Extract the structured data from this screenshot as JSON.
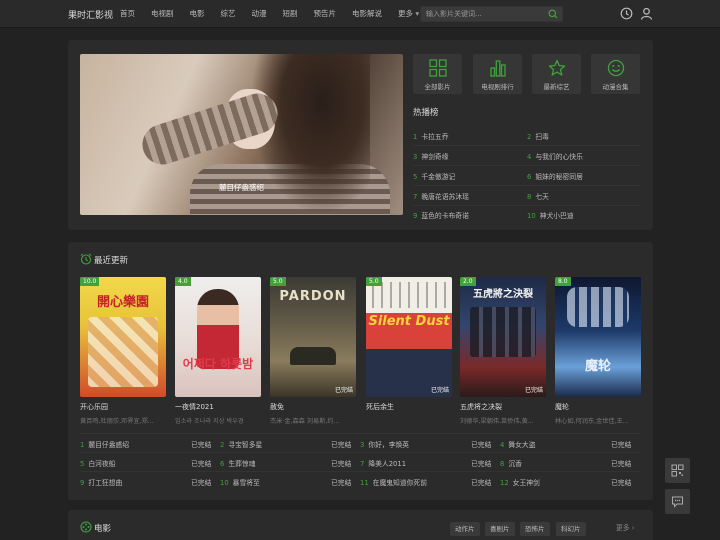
{
  "header": {
    "logo": "果时汇影视",
    "nav": [
      "首页",
      "电视剧",
      "电影",
      "综艺",
      "动漫",
      "短剧",
      "预告片",
      "电影解说",
      "更多"
    ],
    "search_placeholder": "输入影片关键词..."
  },
  "hero": {
    "caption": "麓目仔盎惑绍"
  },
  "tiles": [
    {
      "label": "全部影片",
      "icon": "grid-icon"
    },
    {
      "label": "电视剧排行",
      "icon": "bar-chart-icon"
    },
    {
      "label": "最新综艺",
      "icon": "star-icon"
    },
    {
      "label": "动漫合集",
      "icon": "smile-icon"
    }
  ],
  "hot": {
    "title": "热播榜",
    "items": [
      {
        "n": "1",
        "t": "卡拉五乔"
      },
      {
        "n": "2",
        "t": "扫毒"
      },
      {
        "n": "3",
        "t": "神剑奇缘"
      },
      {
        "n": "4",
        "t": "与我们的心快乐"
      },
      {
        "n": "5",
        "t": "千金傲游记"
      },
      {
        "n": "6",
        "t": "姐妹的秘密同居"
      },
      {
        "n": "7",
        "t": "晚唐花语苏沐瑶"
      },
      {
        "n": "8",
        "t": "七天"
      },
      {
        "n": "9",
        "t": "蓝色的卡布奇诺"
      },
      {
        "n": "10",
        "t": "神犬小巴迪"
      }
    ]
  },
  "recent": {
    "title": "最近更新",
    "movies": [
      {
        "score": "10.0",
        "title": "开心乐园",
        "cast": "黄百鸣,杜丽莎,邓霁宜,郑...",
        "status": "",
        "poster_text": "開心樂園"
      },
      {
        "score": "4.0",
        "title": "一夜情2021",
        "cast": "임소라 조나라 지상 박우경",
        "status": "",
        "poster_text": "어쩌다 하룻밤"
      },
      {
        "score": "5.0",
        "title": "赦免",
        "cast": "杰米·金,森森 刘易斯,约...",
        "status": "已完结",
        "poster_text": "PARDON"
      },
      {
        "score": "5.0",
        "title": "死后余生",
        "cast": "",
        "status": "已完结",
        "poster_text": "Silent Dust"
      },
      {
        "score": "2.0",
        "title": "五虎将之决裂",
        "cast": "刘德华,梁朝伟,苗侨伟,黄...",
        "status": "已完结",
        "poster_text": "五虎將之決裂"
      },
      {
        "score": "8.0",
        "title": "魔轮",
        "cast": "林心如,何润东,金世佳,王...",
        "status": "",
        "poster_text": "魔轮"
      }
    ],
    "ranks": [
      {
        "n": "1",
        "t": "麓目仔盎惑绍",
        "s": "已完结"
      },
      {
        "n": "2",
        "t": "寻宝智多星",
        "s": "已完结"
      },
      {
        "n": "3",
        "t": "你好，李焕英",
        "s": "已完结"
      },
      {
        "n": "4",
        "t": "舞女大盗",
        "s": "已完结"
      },
      {
        "n": "5",
        "t": "白河夜船",
        "s": "已完结"
      },
      {
        "n": "6",
        "t": "生葬惊魂",
        "s": "已完结"
      },
      {
        "n": "7",
        "t": "降美人2011",
        "s": "已完结"
      },
      {
        "n": "8",
        "t": "沉香",
        "s": "已完结"
      },
      {
        "n": "9",
        "t": "打工狂想曲",
        "s": "已完结"
      },
      {
        "n": "10",
        "t": "暴雪将至",
        "s": "已完结"
      },
      {
        "n": "11",
        "t": "在魔鬼知道你死前",
        "s": "已完结"
      },
      {
        "n": "12",
        "t": "女王神剑",
        "s": "已完结"
      }
    ]
  },
  "movie_section": {
    "title": "电影",
    "tags": [
      "动作片",
      "喜剧片",
      "恐怖片",
      "科幻片"
    ],
    "more": "更多"
  },
  "colors": {
    "accent": "#3fa33a",
    "background": "#222222",
    "panel": "#2b2b2b"
  }
}
